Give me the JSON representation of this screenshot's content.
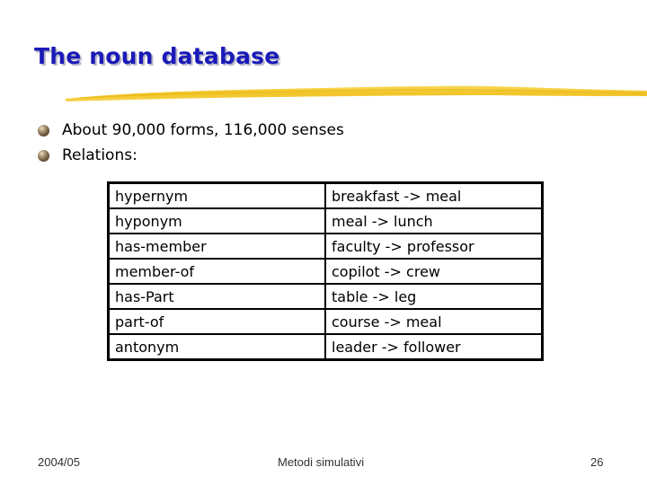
{
  "slide": {
    "title": "The noun database",
    "bullets": [
      {
        "text": "About 90,000 forms, 116,000 senses",
        "icon": "sphere-bullet-icon"
      },
      {
        "text": "Relations:",
        "icon": "sphere-bullet-icon"
      }
    ],
    "relations_table": {
      "rows": [
        {
          "relation": "hypernym",
          "example": "breakfast -> meal"
        },
        {
          "relation": "hyponym",
          "example": "meal -> lunch"
        },
        {
          "relation": "has-member",
          "example": "faculty -> professor"
        },
        {
          "relation": "member-of",
          "example": "copilot -> crew"
        },
        {
          "relation": "has-Part",
          "example": "table -> leg"
        },
        {
          "relation": "part-of",
          "example": "course -> meal"
        },
        {
          "relation": "antonym",
          "example": "leader -> follower"
        }
      ]
    },
    "footer": {
      "left": "2004/05",
      "center": "Metodi simulativi",
      "page_number": "26"
    },
    "colors": {
      "title": "#1a1ab8",
      "accent_stroke": "#f2c21a"
    }
  }
}
